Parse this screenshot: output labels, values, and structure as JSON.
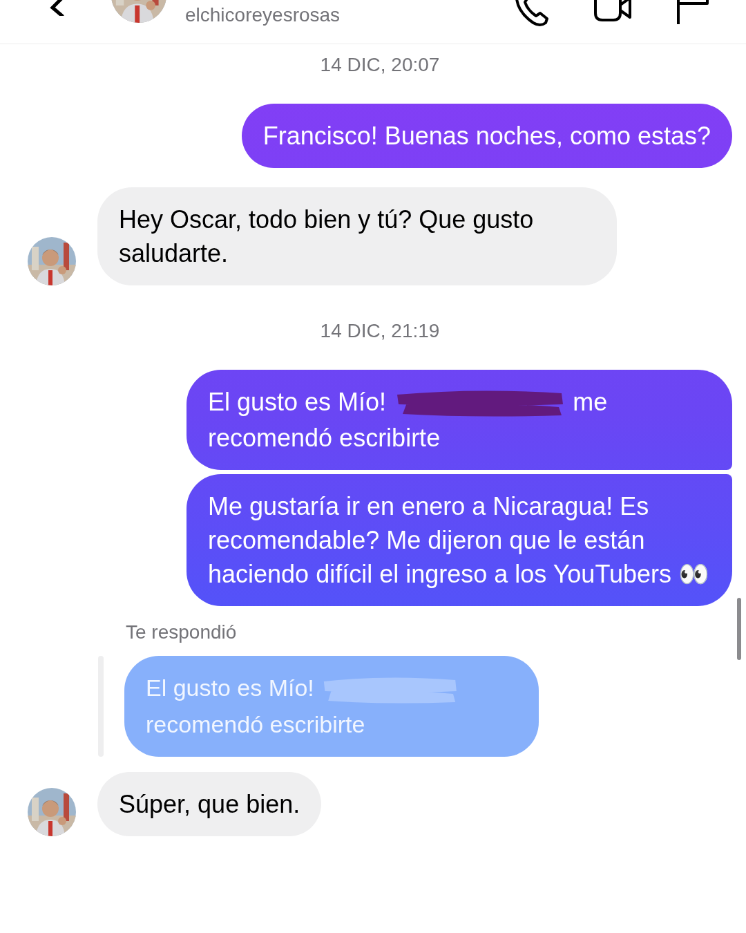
{
  "header": {
    "username": "elchicoreyesrosas"
  },
  "messages": [
    {
      "kind": "timestamp",
      "text": "14 DIC, 20:07"
    },
    {
      "kind": "sent",
      "text": "Francisco! Buenas noches, como estas?"
    },
    {
      "kind": "received",
      "text": "Hey Oscar, todo bien y tú? Que gusto saludarte.",
      "avatar": true
    },
    {
      "kind": "timestamp",
      "text": "14 DIC, 21:19"
    },
    {
      "kind": "sent",
      "text": "El gusto es Mío!",
      "redacted": true,
      "text_after": "me recomendó escribirte"
    },
    {
      "kind": "sent",
      "text": "Me gustaría ir en enero a Nicaragua! Es recomendable? Me dijeron que le están haciendo difícil el ingreso a los YouTubers 👀"
    },
    {
      "kind": "reply_label",
      "text": "Te respondió"
    },
    {
      "kind": "quoted",
      "text": "El gusto es Mío!",
      "redacted": true,
      "text_after": "recomendó escribirte"
    },
    {
      "kind": "received",
      "text": "Súper, que bien.",
      "avatar": true
    }
  ]
}
